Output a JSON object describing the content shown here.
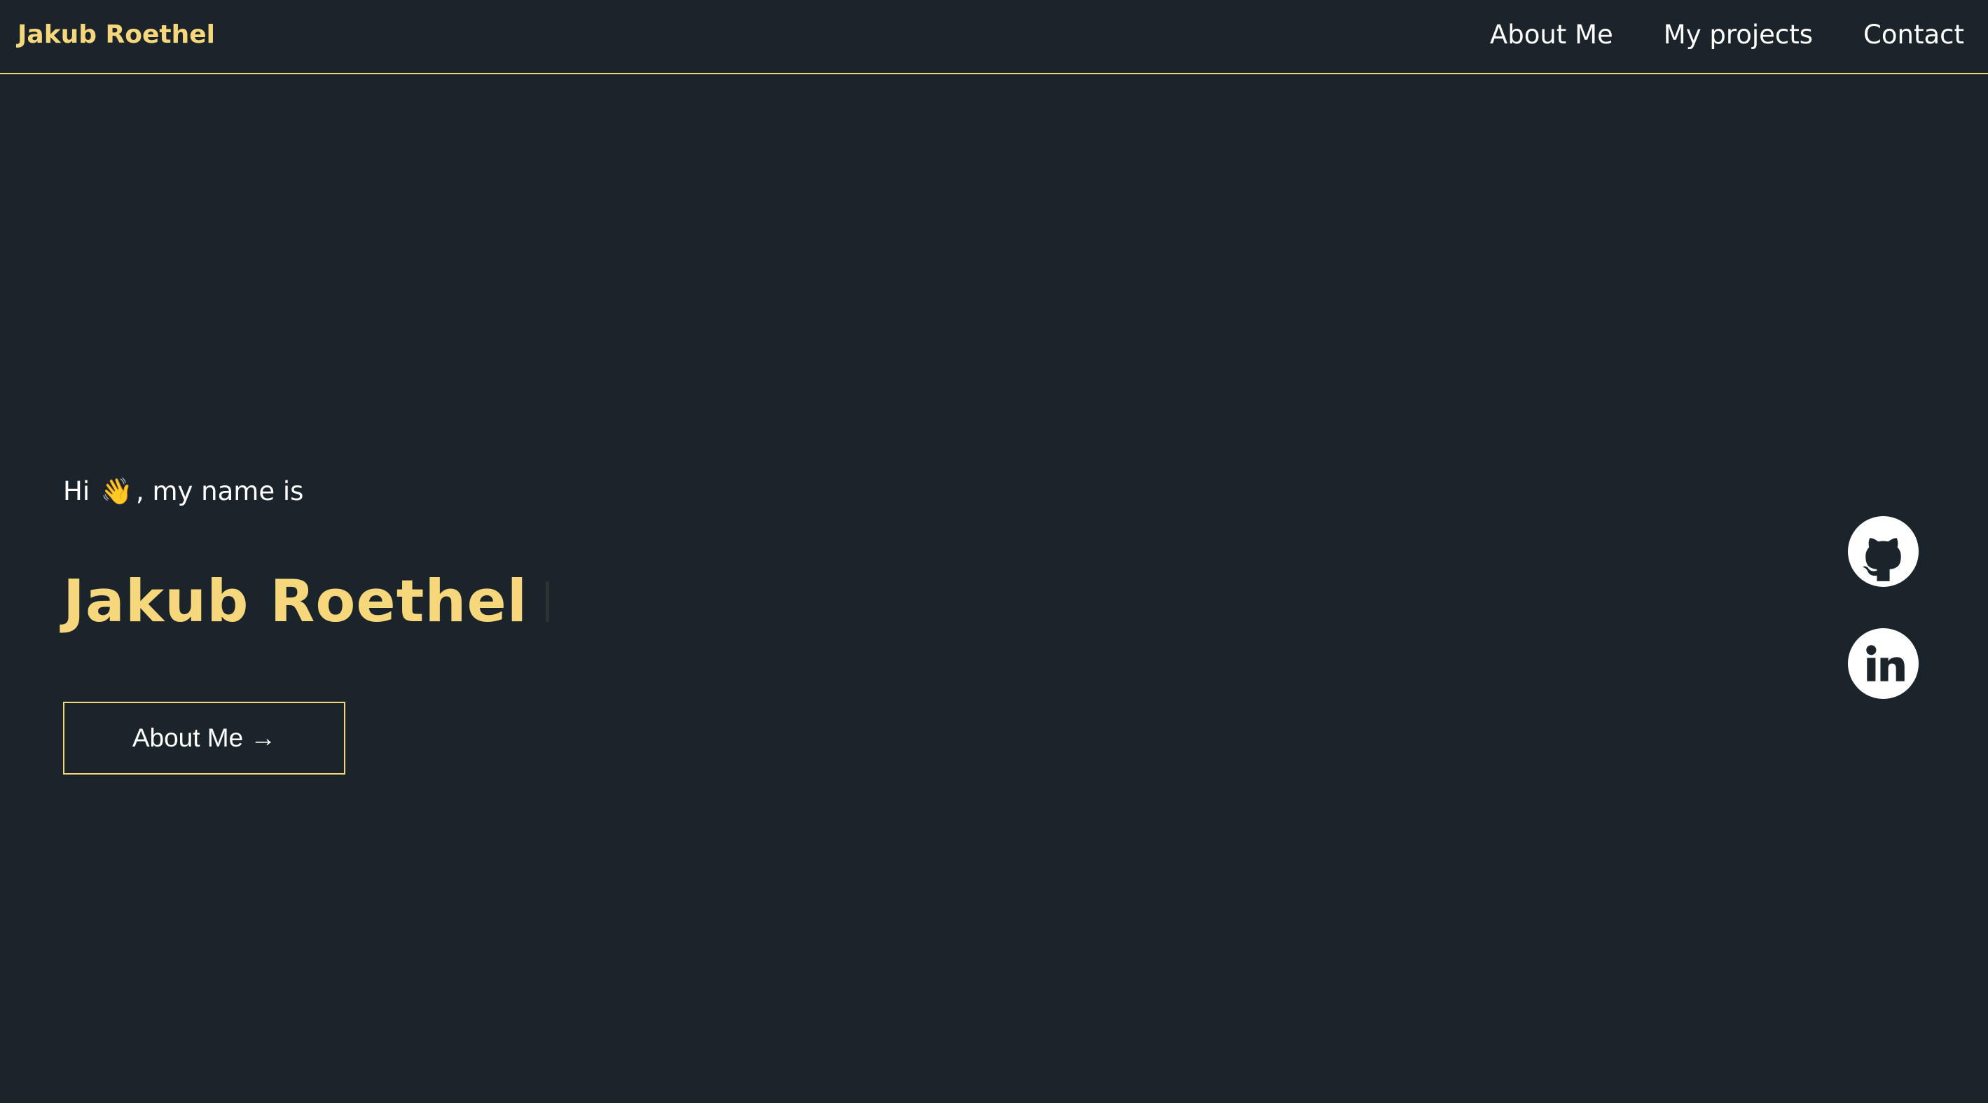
{
  "header": {
    "brand": "Jakub Roethel",
    "nav": [
      {
        "label": "About Me"
      },
      {
        "label": "My projects"
      },
      {
        "label": "Contact"
      }
    ]
  },
  "hero": {
    "greeting_pre": "Hi",
    "wave_emoji": "👋",
    "greeting_post": ", my name is",
    "name": "Jakub Roethel",
    "cta_label": "About Me",
    "cta_arrow": "→"
  },
  "social": {
    "links": [
      {
        "icon": "github-icon"
      },
      {
        "icon": "linkedin-icon"
      }
    ]
  },
  "colors": {
    "background": "#1b242a",
    "accent": "#f6d77c",
    "text": "#ffffff"
  }
}
